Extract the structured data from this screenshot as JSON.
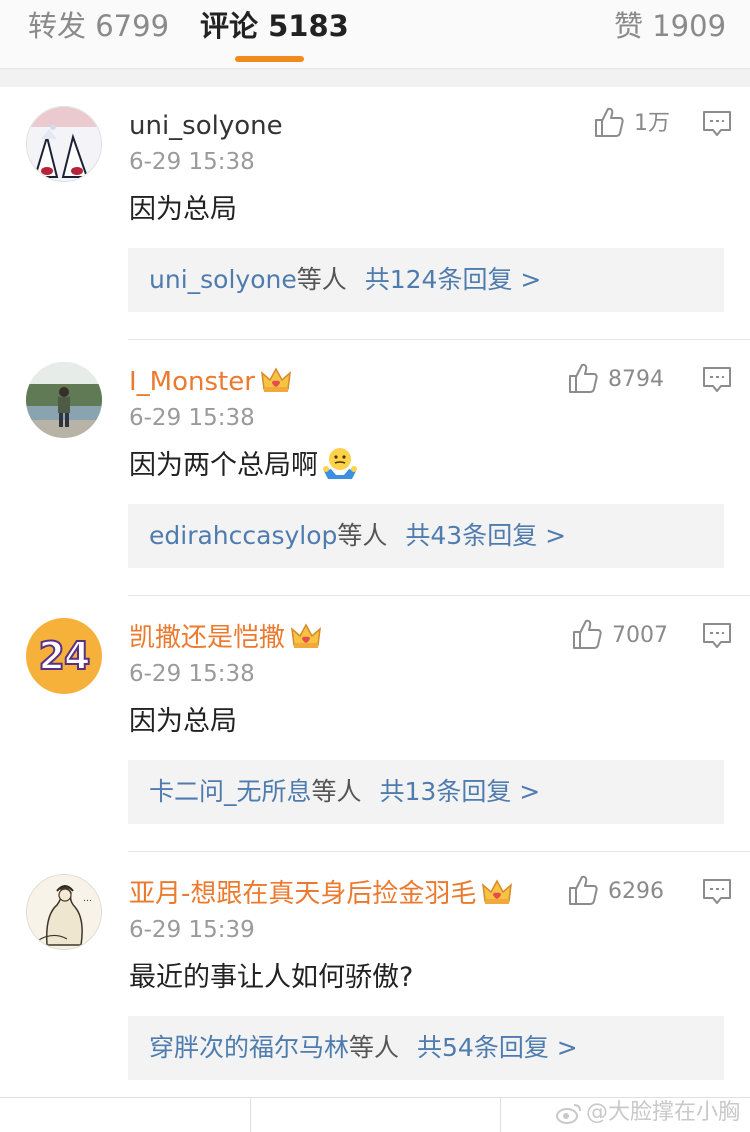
{
  "tabs": {
    "repost": {
      "label": "转发",
      "count": "6799"
    },
    "comments": {
      "label": "评论",
      "count": "5183"
    },
    "likes": {
      "label": "赞",
      "count": "1909"
    }
  },
  "comments": [
    {
      "username": "uni_solyone",
      "timestamp": "6-29 15:38",
      "text": "因为总局",
      "likes": "1万",
      "reply_users": "uni_solyone",
      "reply_suffix": "等人",
      "reply_count": "共124条回复 >"
    },
    {
      "username": "I_Monster",
      "timestamp": "6-29 15:38",
      "text": "因为两个总局啊",
      "likes": "8794",
      "reply_users": "edirahccasylop",
      "reply_suffix": "等人",
      "reply_count": "共43条回复 >"
    },
    {
      "username": "凯撒还是恺撒",
      "timestamp": "6-29 15:38",
      "text": "因为总局",
      "likes": "7007",
      "reply_users": "卡二问_无所息",
      "reply_suffix": "等人",
      "reply_count": "共13条回复 >",
      "avatar_text": "24"
    },
    {
      "username": "亚月-想跟在真天身后捡金羽毛",
      "timestamp": "6-29 15:39",
      "text": "最近的事让人如何骄傲?",
      "likes": "6296",
      "reply_users": "穿胖次的福尔马林",
      "reply_suffix": "等人",
      "reply_count": "共54条回复 >"
    }
  ],
  "watermark": "@大脸撑在小胸",
  "colors": {
    "accent": "#f28b1d",
    "vip_name": "#eb7a2e",
    "link": "#4f7cae"
  }
}
